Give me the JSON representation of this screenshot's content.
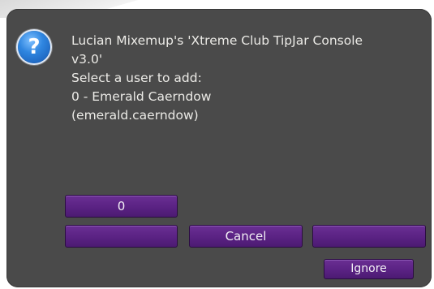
{
  "dialog": {
    "icon": "help-question-icon",
    "message": "Lucian Mixemup's 'Xtreme Club TipJar Console\nv3.0'\nSelect a user to add:\n0 - Emerald Caerndow\n   (emerald.caerndow)",
    "icon_glyph": "?"
  },
  "buttons": {
    "option_0": "0",
    "row2_left": "",
    "cancel": "Cancel",
    "row2_right": "",
    "ignore": "Ignore"
  },
  "colors": {
    "dialog_bg": "#4a4a4a",
    "button_purple": "#5a2283",
    "text": "#ecebe7",
    "icon_blue": "#2f86e0"
  }
}
